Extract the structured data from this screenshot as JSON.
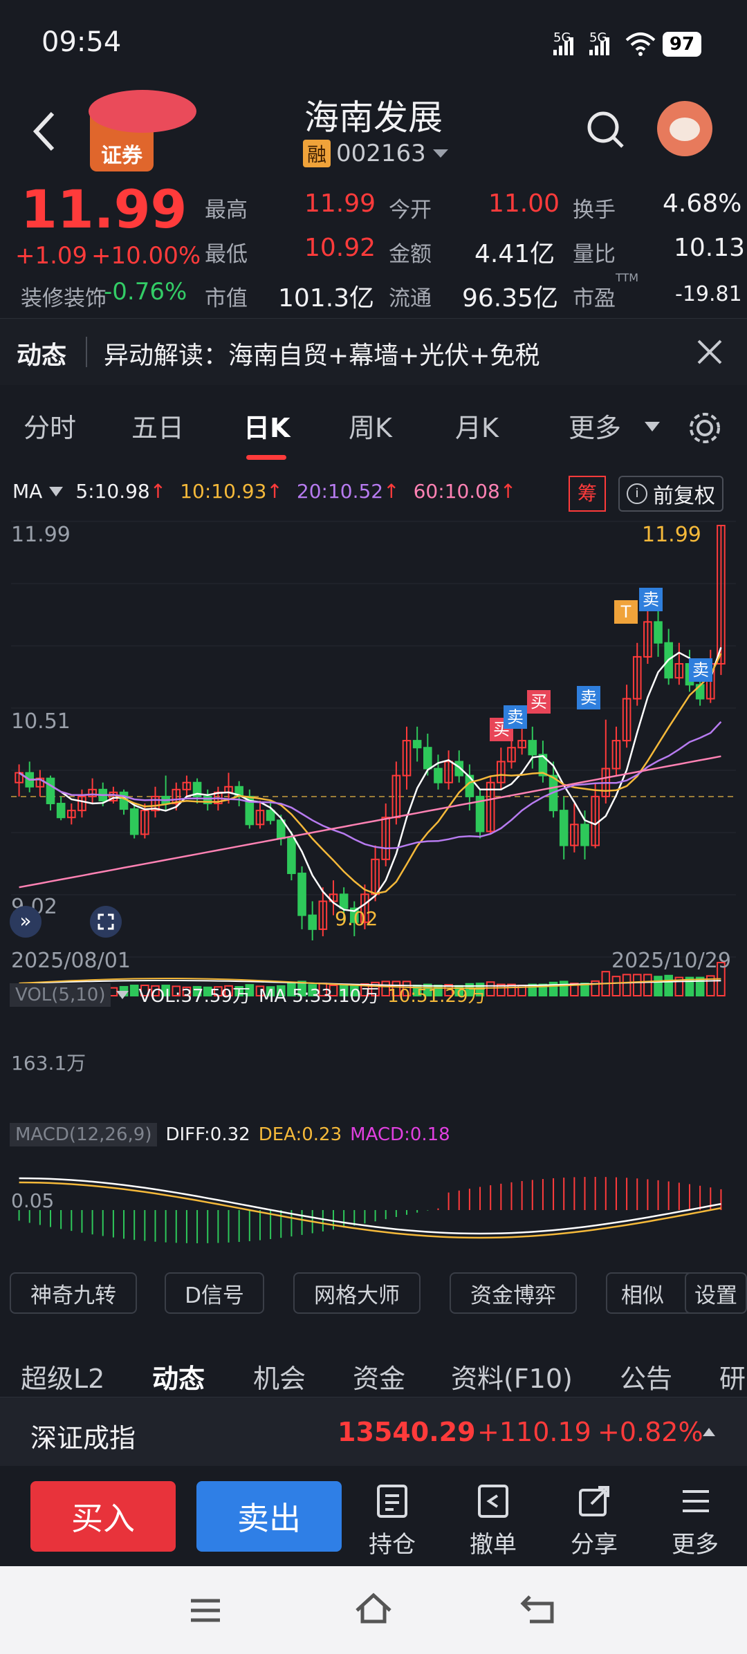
{
  "status_bar": {
    "time": "09:54",
    "signal1": "5G",
    "signal2": "5G",
    "battery": "97"
  },
  "header": {
    "title": "海南发展",
    "margin_badge": "融",
    "code": "002163",
    "broker_badge": "证券"
  },
  "quote": {
    "price": "11.99",
    "change": "+1.09",
    "change_pct": "+10.00%",
    "sector": "装修装饰",
    "sector_pct": "-0.76%",
    "cols": [
      {
        "label": "最高",
        "value": "11.99",
        "color": "#ff3b3b"
      },
      {
        "label": "最低",
        "value": "10.92",
        "color": "#ff3b3b"
      },
      {
        "label": "市值",
        "value": "101.3亿",
        "color": "#f2f2f4"
      },
      {
        "label": "今开",
        "value": "11.00",
        "color": "#ff3b3b"
      },
      {
        "label": "金额",
        "value": "4.41亿",
        "color": "#f2f2f4"
      },
      {
        "label": "流通",
        "value": "96.35亿",
        "color": "#f2f2f4"
      },
      {
        "label": "换手",
        "value": "4.68%",
        "color": "#f2f2f4"
      },
      {
        "label": "量比",
        "value": "10.13",
        "color": "#f2f2f4"
      },
      {
        "label": "市盈",
        "value": "-19.81",
        "color": "#f2f2f4"
      }
    ],
    "ttm": "TTM"
  },
  "news": {
    "tag": "动态",
    "text": "异动解读：海南自贸+幕墙+光伏+免税"
  },
  "ktabs": {
    "items": [
      "分时",
      "五日",
      "日K",
      "周K",
      "月K",
      "更多"
    ],
    "active": "日K"
  },
  "ma_bar": {
    "label": "MA",
    "ma5": "5:10.98",
    "ma10": "10:10.93",
    "ma20": "20:10.52",
    "ma60": "60:10.08",
    "chip": "筹",
    "adjust": "前复权"
  },
  "chart_data": {
    "type": "candlestick",
    "y_labels": [
      "11.99",
      "10.51",
      "9.02"
    ],
    "high_label": "11.99",
    "low_label": "9.02",
    "x_start": "2025/08/01",
    "x_end": "2025/10/29",
    "markers": [
      "买",
      "卖",
      "买",
      "卖",
      "T",
      "卖",
      "卖"
    ],
    "ylim": [
      9.02,
      11.99
    ],
    "candles": [
      [
        10.15,
        10.22,
        10.05,
        10.28
      ],
      [
        10.22,
        10.12,
        10.08,
        10.3
      ],
      [
        10.12,
        10.18,
        10.05,
        10.24
      ],
      [
        10.18,
        10.0,
        9.95,
        10.2
      ],
      [
        10.0,
        9.9,
        9.88,
        10.05
      ],
      [
        9.9,
        9.95,
        9.85,
        10.0
      ],
      [
        9.95,
        10.05,
        9.9,
        10.1
      ],
      [
        10.05,
        10.1,
        10.0,
        10.18
      ],
      [
        10.1,
        10.02,
        9.98,
        10.15
      ],
      [
        10.02,
        10.08,
        10.0,
        10.12
      ],
      [
        10.08,
        9.96,
        9.92,
        10.1
      ],
      [
        9.96,
        9.78,
        9.75,
        10.0
      ],
      [
        9.78,
        9.95,
        9.75,
        10.0
      ],
      [
        9.95,
        10.05,
        9.9,
        10.12
      ],
      [
        10.05,
        10.0,
        9.95,
        10.2
      ],
      [
        10.0,
        10.1,
        9.95,
        10.15
      ],
      [
        10.1,
        10.15,
        10.05,
        10.2
      ],
      [
        10.15,
        10.05,
        10.0,
        10.18
      ],
      [
        10.05,
        10.0,
        9.95,
        10.1
      ],
      [
        10.0,
        10.08,
        9.95,
        10.12
      ],
      [
        10.08,
        10.12,
        10.0,
        10.22
      ],
      [
        10.12,
        10.05,
        9.98,
        10.16
      ],
      [
        10.05,
        9.85,
        9.82,
        10.1
      ],
      [
        9.85,
        9.95,
        9.82,
        10.02
      ],
      [
        9.95,
        9.88,
        9.85,
        10.02
      ],
      [
        9.88,
        9.75,
        9.7,
        9.92
      ],
      [
        9.75,
        9.5,
        9.45,
        9.8
      ],
      [
        9.5,
        9.2,
        9.1,
        9.55
      ],
      [
        9.2,
        9.1,
        9.02,
        9.3
      ],
      [
        9.1,
        9.3,
        9.05,
        9.4
      ],
      [
        9.3,
        9.35,
        9.2,
        9.45
      ],
      [
        9.35,
        9.25,
        9.15,
        9.4
      ],
      [
        9.25,
        9.15,
        9.05,
        9.3
      ],
      [
        9.15,
        9.35,
        9.1,
        9.42
      ],
      [
        9.35,
        9.6,
        9.3,
        9.7
      ],
      [
        9.6,
        9.9,
        9.55,
        10.0
      ],
      [
        9.9,
        10.2,
        9.85,
        10.3
      ],
      [
        10.2,
        10.45,
        10.1,
        10.55
      ],
      [
        10.45,
        10.4,
        10.3,
        10.55
      ],
      [
        10.4,
        10.25,
        10.2,
        10.5
      ],
      [
        10.25,
        10.15,
        10.1,
        10.35
      ],
      [
        10.15,
        10.3,
        10.1,
        10.38
      ],
      [
        10.3,
        10.2,
        10.15,
        10.38
      ],
      [
        10.2,
        10.05,
        9.95,
        10.28
      ],
      [
        10.05,
        9.8,
        9.75,
        10.1
      ],
      [
        9.8,
        10.15,
        9.78,
        10.2
      ],
      [
        10.15,
        10.3,
        10.1,
        10.4
      ],
      [
        10.3,
        10.4,
        10.25,
        10.55
      ],
      [
        10.4,
        10.45,
        10.35,
        10.6
      ],
      [
        10.45,
        10.35,
        10.25,
        10.55
      ],
      [
        10.35,
        10.2,
        10.15,
        10.45
      ],
      [
        10.2,
        9.95,
        9.9,
        10.3
      ],
      [
        9.95,
        9.7,
        9.6,
        10.05
      ],
      [
        9.7,
        9.85,
        9.65,
        10.0
      ],
      [
        9.85,
        9.7,
        9.6,
        9.95
      ],
      [
        9.7,
        10.05,
        9.68,
        10.15
      ],
      [
        10.05,
        10.25,
        10.0,
        10.6
      ],
      [
        10.25,
        10.45,
        10.2,
        10.55
      ],
      [
        10.45,
        10.75,
        10.4,
        10.85
      ],
      [
        10.75,
        11.05,
        10.7,
        11.15
      ],
      [
        11.05,
        11.3,
        11.0,
        11.45
      ],
      [
        11.3,
        11.15,
        11.05,
        11.4
      ],
      [
        11.15,
        10.9,
        10.85,
        11.25
      ],
      [
        10.9,
        11.0,
        10.85,
        11.15
      ],
      [
        11.0,
        10.85,
        10.8,
        11.1
      ],
      [
        10.85,
        10.75,
        10.7,
        11.0
      ],
      [
        10.75,
        11.0,
        10.72,
        11.1
      ],
      [
        11.0,
        11.99,
        10.92,
        11.99
      ]
    ],
    "ma_lines": [
      {
        "name": "MA5",
        "color": "#ffffff"
      },
      {
        "name": "MA10",
        "color": "#f5b93a"
      },
      {
        "name": "MA20",
        "color": "#b77bf0"
      },
      {
        "name": "MA60",
        "color": "#ff82b4"
      }
    ],
    "vol": {
      "header": "VOL(5,10)",
      "vol": "VOL:37.59万",
      "ma5": "MA 5:33.10万",
      "ma10": "10:51.29万",
      "ylabel": "163.1万"
    },
    "macd": {
      "header": "MACD(12,26,9)",
      "diff": "DIFF:0.32",
      "dea": "DEA:0.23",
      "macd": "MACD:0.18",
      "ylabel": "0.05"
    }
  },
  "tools": [
    "神奇九转",
    "D信号",
    "网格大师",
    "资金博弈",
    "相似",
    "设置"
  ],
  "subtabs": [
    "超级L2",
    "动态",
    "机会",
    "资金",
    "资料(F10)",
    "公告",
    "研"
  ],
  "index": {
    "name": "深证成指",
    "value": "13540.29",
    "change": "+110.19",
    "pct": "+0.82%"
  },
  "trade": {
    "buy": "买入",
    "sell": "卖出",
    "actions": [
      "持仓",
      "撤单",
      "分享",
      "更多"
    ]
  }
}
